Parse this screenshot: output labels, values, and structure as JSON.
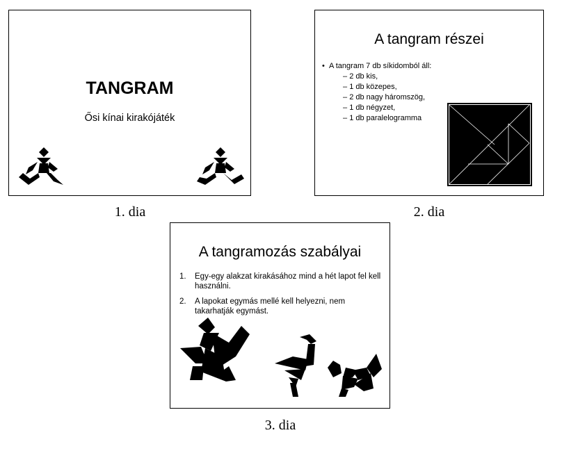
{
  "slides": [
    {
      "caption": "1. dia",
      "title": "TANGRAM",
      "subtitle": "Ősi kínai kirakójáték",
      "figures": [
        "tangram-runner-figure",
        "tangram-runner-figure"
      ]
    },
    {
      "caption": "2. dia",
      "title": "A tangram részei",
      "bullet_main": "A tangram 7 db síkidomból áll:",
      "sub_items": [
        "2 db kis,",
        "1 db közepes,",
        "2 db nagy háromszög,",
        "1 db négyzet,",
        "1 db paralelogramma"
      ],
      "figure": "tangram-square-figure"
    },
    {
      "caption": "3. dia",
      "title": "A tangramozás szabályai",
      "rules": [
        {
          "num": "1.",
          "text": "Egy-egy alakzat kirakásához mind a hét lapot fel kell használni."
        },
        {
          "num": "2.",
          "text": "A lapokat egymás mellé kell helyezni, nem takarhatják egymást."
        }
      ],
      "figures": [
        "tangram-bird-figure",
        "tangram-swan-figure",
        "tangram-cat-figure"
      ]
    }
  ],
  "colors": {
    "ink": "#000000",
    "slide_bg": "#ffffff",
    "tangram_lines": "#ffffff"
  }
}
